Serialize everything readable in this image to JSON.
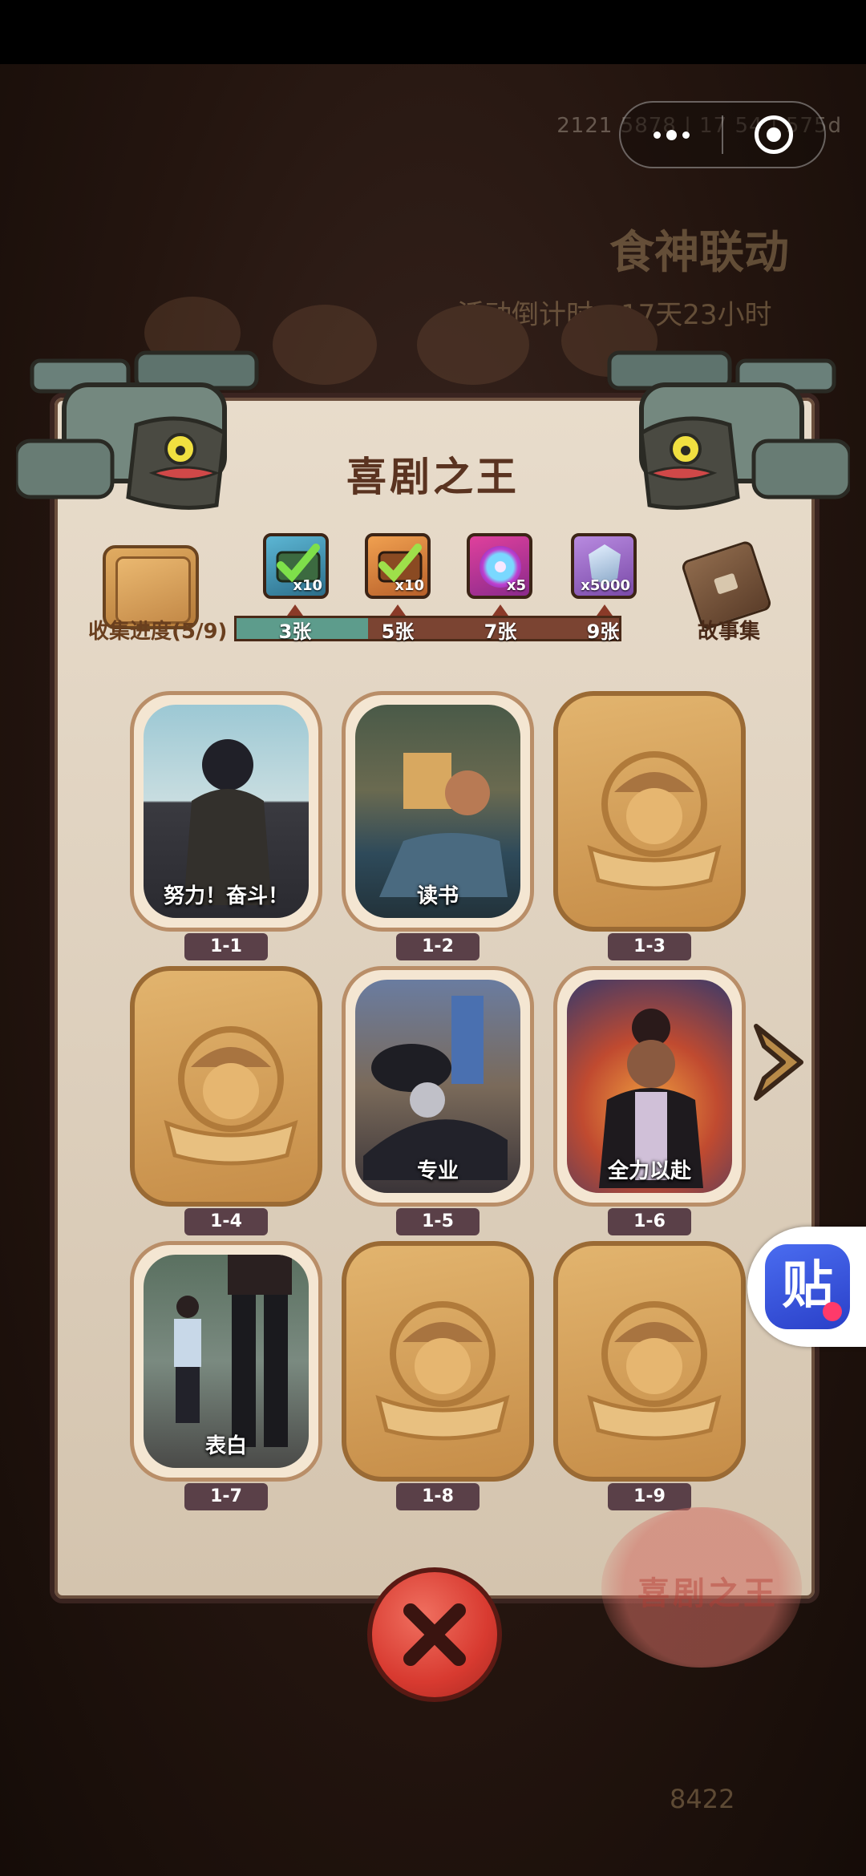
{
  "background": {
    "id_text": "2121 5878 | 17 54 | 575d",
    "event_title": "食神联动",
    "countdown": "活动倒计时：17天23小时",
    "count": "8422"
  },
  "capsule": {
    "more_icon": "more-dots-icon",
    "close_icon": "target-close-icon"
  },
  "panel": {
    "title": "喜剧之王",
    "collection_label": "收集进度(5/9)",
    "story_label": "故事集",
    "progress": {
      "collected": 5,
      "total": 9
    },
    "tiers": [
      {
        "label": "3张",
        "reward_icon": "green-check-crate-icon",
        "qty": "x10"
      },
      {
        "label": "5张",
        "reward_icon": "orange-check-crate-icon",
        "qty": "x10"
      },
      {
        "label": "7张",
        "reward_icon": "magenta-disc-icon",
        "qty": "x5"
      },
      {
        "label": "9张",
        "reward_icon": "crystal-gem-icon",
        "qty": "x5000"
      }
    ],
    "cards": [
      {
        "id": "1-1",
        "title": "努力！奋斗！",
        "unlocked": true
      },
      {
        "id": "1-2",
        "title": "读书",
        "unlocked": true
      },
      {
        "id": "1-3",
        "title": "",
        "unlocked": false
      },
      {
        "id": "1-4",
        "title": "",
        "unlocked": false
      },
      {
        "id": "1-5",
        "title": "专业",
        "unlocked": true
      },
      {
        "id": "1-6",
        "title": "全力以赴",
        "unlocked": true
      },
      {
        "id": "1-7",
        "title": "表白",
        "unlocked": true
      },
      {
        "id": "1-8",
        "title": "",
        "unlocked": false
      },
      {
        "id": "1-9",
        "title": "",
        "unlocked": false
      }
    ],
    "seal_text": "喜剧之王"
  },
  "tie_widget": {
    "label": "贴"
  },
  "colors": {
    "panel": "#e8dccb",
    "progress_fill": "#5d9c8c",
    "progress_track": "#7b4432",
    "close": "#d83a30",
    "card_locked": "#d9a25c"
  }
}
